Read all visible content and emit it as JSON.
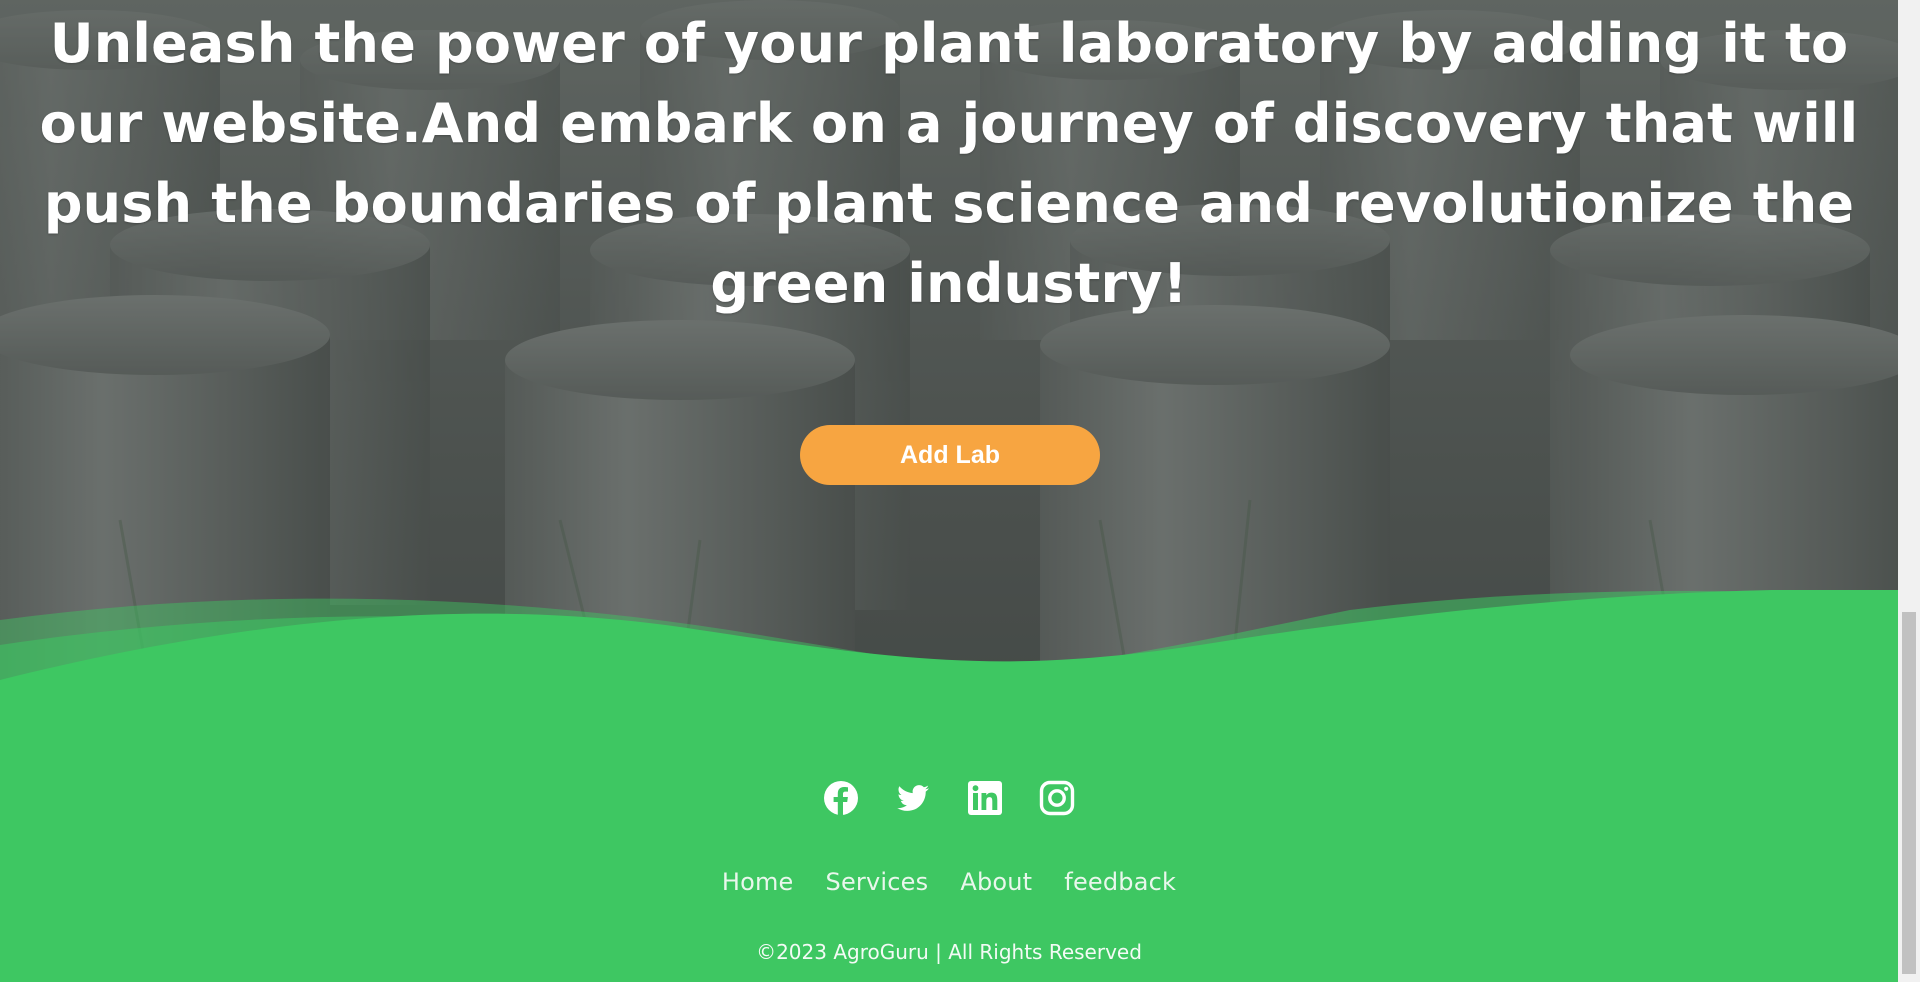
{
  "hero": {
    "heading": "Unleash the power of your plant laboratory by adding it to our website.And embark on a journey of discovery that will push the boundaries of plant science and revolutionize the green industry!",
    "button_label": "Add Lab"
  },
  "footer": {
    "social": [
      {
        "icon": "facebook-icon"
      },
      {
        "icon": "twitter-icon"
      },
      {
        "icon": "linkedin-icon"
      },
      {
        "icon": "instagram-icon"
      }
    ],
    "nav": [
      {
        "label": "Home"
      },
      {
        "label": "Services"
      },
      {
        "label": "About"
      },
      {
        "label": "feedback"
      }
    ],
    "copyright": "©2023 AgroGuru | All Rights Reserved"
  },
  "colors": {
    "accent": "#f7a541",
    "footer_green": "#3ec762",
    "hero_overlay": "#5c605d"
  }
}
